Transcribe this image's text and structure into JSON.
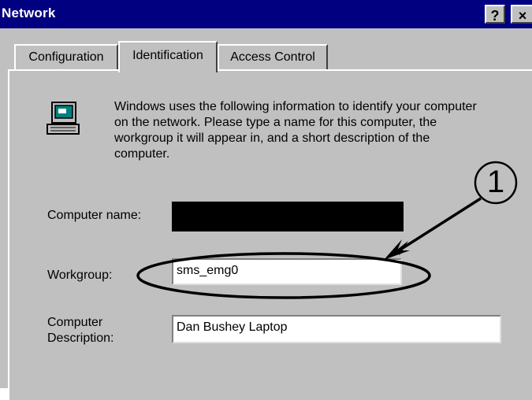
{
  "window": {
    "title": "Network",
    "help_label": "?",
    "close_label": "×"
  },
  "tabs": [
    {
      "label": "Configuration"
    },
    {
      "label": "Identification"
    },
    {
      "label": "Access Control"
    }
  ],
  "identification": {
    "icon": "computer-icon",
    "description": "Windows uses the following information to identify your computer on the network. Please type a name for this computer, the workgroup it will appear in, and a short description of the computer.",
    "computer_name_label": "Computer name:",
    "computer_name_value": "",
    "workgroup_label": "Workgroup:",
    "workgroup_value": "sms_emg0",
    "computer_description_label": "Computer Description:",
    "computer_description_value": "Dan Bushey Laptop"
  },
  "callout": {
    "number": "1"
  },
  "colors": {
    "titlebar": "#000080",
    "dialog": "#c0c0c0",
    "field": "#ffffff"
  }
}
